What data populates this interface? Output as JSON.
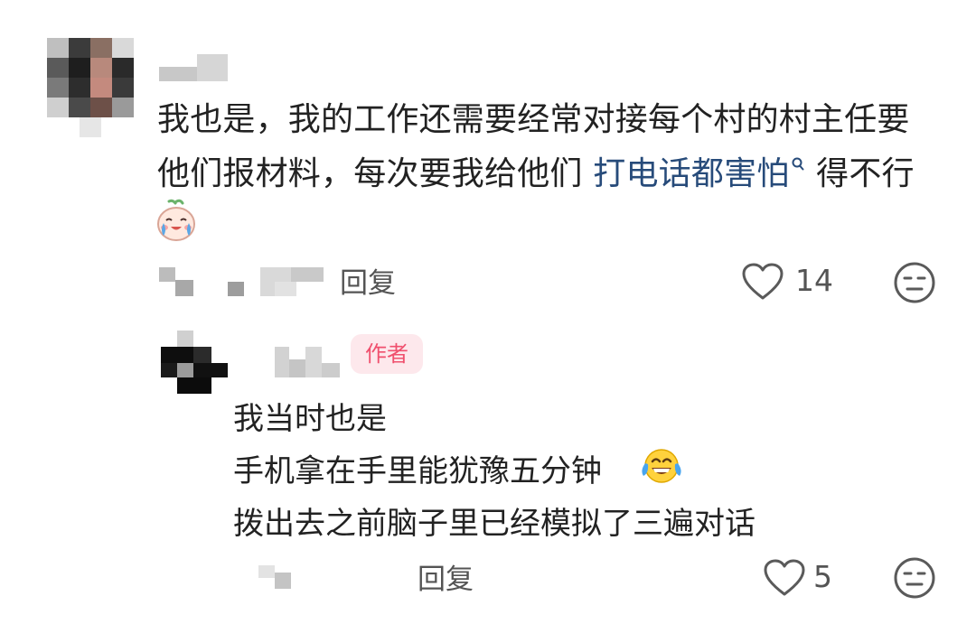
{
  "comment": {
    "line1": "我也是，我的工作还需要经常对接每个村的村主任要",
    "line2_before": "他们报材料，每次要我给他们",
    "line2_link": "打电话都害怕",
    "line2_after": "得不行",
    "reply_label": "回复",
    "like_count": "14"
  },
  "reply": {
    "author_badge": "作者",
    "line1": "我当时也是",
    "line2": "手机拿在手里能犹豫五分钟",
    "line3": "拨出去之前脑子里已经模拟了三遍对话",
    "reply_label": "回复",
    "like_count": "5"
  },
  "icons": {
    "heart": "heart-outline-icon",
    "dislike": "neutral-face-icon",
    "search": "search-icon",
    "emoji_cry": "crying-emoji-icon",
    "emoji_laugh": "laughing-tears-emoji-icon"
  },
  "colors": {
    "link": "#274b7a",
    "author_badge_bg": "#fde8ec",
    "author_badge_text": "#f0506e",
    "meta_text": "#545454"
  }
}
